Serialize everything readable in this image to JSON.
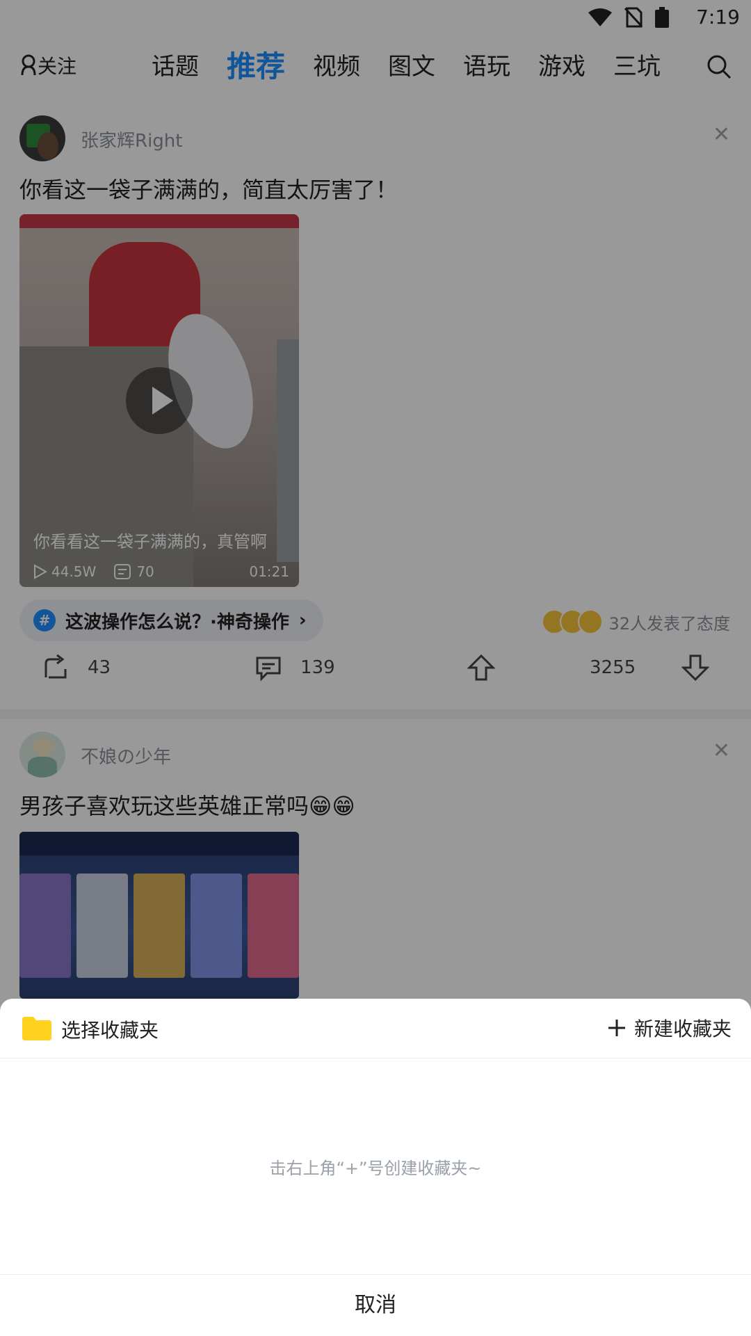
{
  "status_bar": {
    "time": "7:19"
  },
  "top_nav": {
    "follow_label": "关注",
    "tabs": [
      "话题",
      "推荐",
      "视频",
      "图文",
      "语玩",
      "游戏",
      "三坑"
    ],
    "active_tab": "推荐"
  },
  "posts": [
    {
      "username": "张家辉Right",
      "text": "你看这一袋子满满的，简直太厉害了！",
      "video": {
        "caption": "你看看这一袋子满满的，真管啊",
        "plays": "44.5W",
        "comments": "70",
        "duration": "01:21"
      },
      "topic": "这波操作怎么说？·神奇操作",
      "attitude": "32人发表了态度",
      "share_count": "43",
      "comment_count": "139",
      "upvote_count": "3255"
    },
    {
      "username": "不娘の少年",
      "text": "男孩子喜欢玩这些英雄正常吗😁😁"
    }
  ],
  "sheet": {
    "title": "选择收藏夹",
    "new_button": "新建收藏夹",
    "hint": "击右上角“+”号创建收藏夹~",
    "cancel": "取消"
  },
  "colors": {
    "accent": "#1f8fff",
    "folder": "#ffd21f"
  },
  "icons": [
    "wifi-icon",
    "no-sim-icon",
    "battery-icon",
    "search-icon",
    "close-icon",
    "play-icon",
    "share-icon",
    "comment-icon",
    "upvote-icon",
    "downvote-icon",
    "folder-icon",
    "plus-icon"
  ]
}
